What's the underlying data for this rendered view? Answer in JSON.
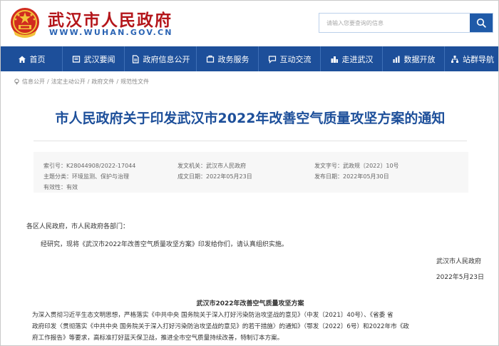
{
  "header": {
    "site_title": "武汉市人民政府",
    "site_url": "WWW.WUHAN.GOV.CN",
    "search_placeholder": "请输入您要查询的信息"
  },
  "nav": {
    "items": [
      {
        "label": "首页",
        "icon": "home-icon"
      },
      {
        "label": "武汉要闻",
        "icon": "news-icon"
      },
      {
        "label": "政府信息公开",
        "icon": "document-icon"
      },
      {
        "label": "政务服务",
        "icon": "service-icon"
      },
      {
        "label": "互动交流",
        "icon": "chat-icon"
      },
      {
        "label": "走进武汉",
        "icon": "city-icon"
      },
      {
        "label": "数据开放",
        "icon": "data-icon"
      },
      {
        "label": "站群导航",
        "icon": "sitemap-icon"
      }
    ]
  },
  "breadcrumb": {
    "items": [
      "信息公开",
      "法定主动公开",
      "政府文件",
      "规范性文件"
    ],
    "separator": "/"
  },
  "doc": {
    "title": "市人民政府关于印发武汉市2022年改善空气质量攻坚方案的通知",
    "meta": {
      "index_label": "索引号：",
      "index_value": "K28044908/2022-17044",
      "subject_label": "主题分类：",
      "subject_value": "环境监测、保护与治理",
      "validity_label": "有效性：",
      "validity_value": "有效",
      "issuer_label": "发文机关：",
      "issuer_value": "武汉市人民政府",
      "created_label": "成文日期：",
      "created_value": "2022年05月23日",
      "docno_label": "发文字号：",
      "docno_value": "武政规〔2022〕10号",
      "published_label": "发布日期：",
      "published_value": "2022年05月30日"
    },
    "salutation": "各区人民政府，市人民政府各部门：",
    "body": "经研究，现将《武汉市2022年改善空气质量攻坚方案》印发给你们，请认真组织实施。",
    "signature": "武汉市人民政府",
    "date": "2022年5月23日",
    "section_title": "武汉市2022年改善空气质量攻坚方案",
    "paragraph_lines": [
      "为深入贯彻习近平生态文明思想，严格落实《中共中央 国务院关于深入打好污染防治攻坚战的意见》（中发〔2021〕40号）、《省委 省",
      "政府印发〈贯彻落实《中共中央 国务院关于深入打好污染防治攻坚战的意见》的若干措施〉的通知》（鄂发〔2022〕6号）和2022年市《政",
      "府工作报告》等要求，高标准打好蓝天保卫战，推进全市空气质量持续改善，特制订本方案。"
    ]
  },
  "colors": {
    "brand_red": "#b4161b",
    "nav_blue": "#1d4f9a",
    "title_blue": "#1d4f9a"
  }
}
